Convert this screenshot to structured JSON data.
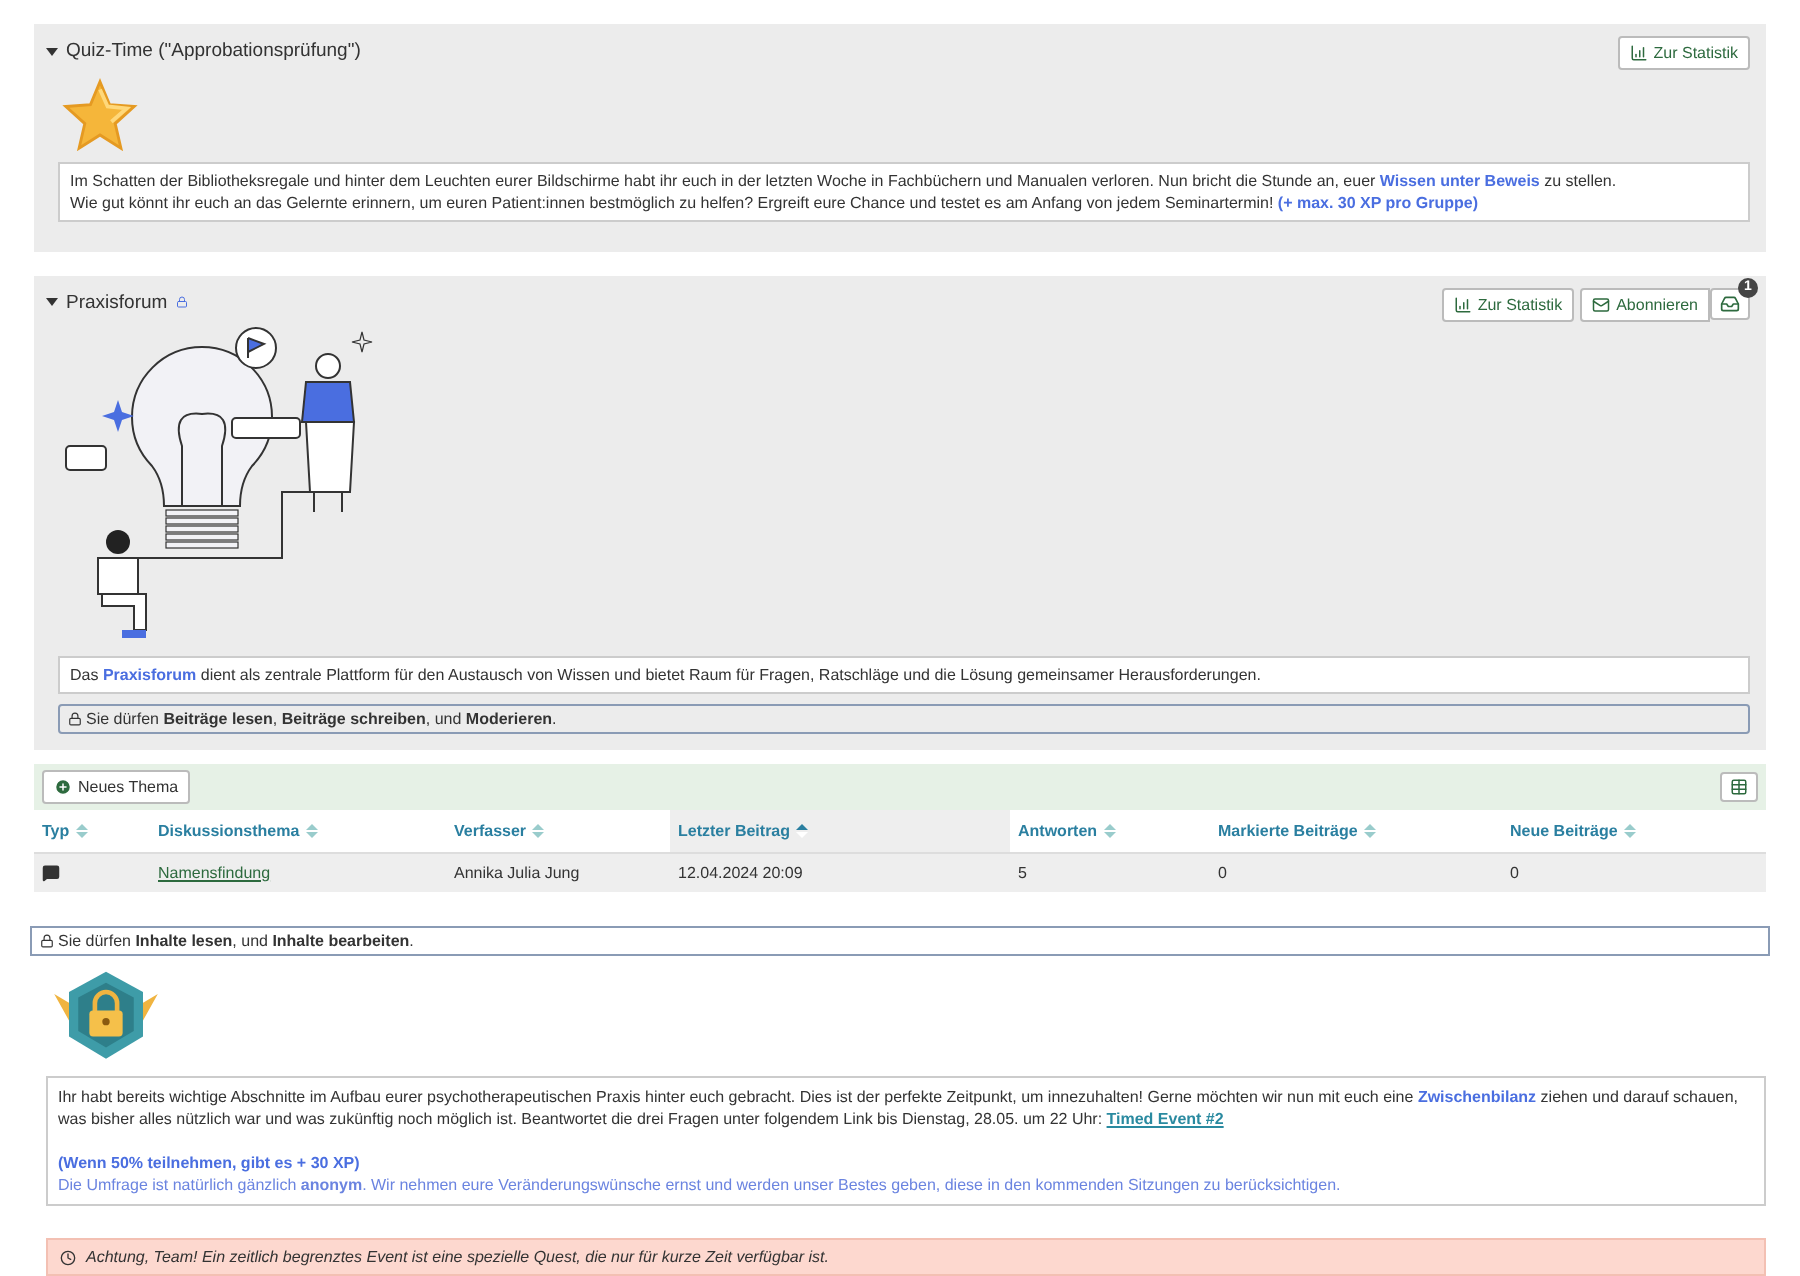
{
  "quiz_panel": {
    "title": "Quiz-Time (\"Approbationsprüfung\")",
    "expanded": true,
    "stat_button": "Zur Statistik",
    "text_lines": [
      [
        {
          "kind": "text",
          "text": "Im Schatten der Bibliotheksregale und hinter dem Leuchten eurer Bildschirme habt ihr euch in der letzten Woche in Fachbüchern und Manualen verloren. Nun bricht die Stunde an, euer "
        },
        {
          "kind": "accent",
          "text": "Wissen unter Beweis"
        },
        {
          "kind": "text",
          "text": " zu stellen."
        }
      ],
      [
        {
          "kind": "text",
          "text": "Wie gut könnt ihr euch an das Gelernte erinnern, um euren Patient:innen bestmöglich zu helfen? Ergreift eure Chance und testet es am Anfang von jedem Seminartermin! "
        },
        {
          "kind": "accent",
          "text": "(+ max. 30 XP pro Gruppe)"
        }
      ]
    ]
  },
  "forum_panel": {
    "title": "Praxisforum",
    "expanded": true,
    "stat_button": "Zur Statistik",
    "subscribe_button": "Abonnieren",
    "notification_count": "1",
    "description": [
      {
        "kind": "text",
        "text": "Das "
      },
      {
        "kind": "accent",
        "text": "Praxisforum"
      },
      {
        "kind": "text",
        "text": " dient als zentrale Plattform für den Austausch von Wissen und bietet Raum für Fragen, Ratschläge und die Lösung gemeinsamer Herausforderungen."
      }
    ],
    "permission": "Sie dürfen **Beiträge lesen**, **Beiträge schreiben**, und **Moderieren**."
  },
  "forum_table": {
    "new_topic_button": "Neues Thema",
    "columns": [
      {
        "label": "Typ",
        "sorted": false
      },
      {
        "label": "Diskussionsthema",
        "sorted": false
      },
      {
        "label": "Verfasser",
        "sorted": false
      },
      {
        "label": "Letzter Beitrag",
        "sorted": true
      },
      {
        "label": "Antworten",
        "sorted": false
      },
      {
        "label": "Markierte Beiträge",
        "sorted": false
      },
      {
        "label": "Neue Beiträge",
        "sorted": false
      }
    ],
    "rows": [
      {
        "topic": "Namensfindung",
        "author": "Annika Julia Jung",
        "last_post": "12.04.2024 20:09",
        "replies": "5",
        "marked": "0",
        "new": "0"
      }
    ]
  },
  "content_permission": "Sie dürfen **Inhalte lesen**, und **Inhalte bearbeiten**.",
  "event_text": [
    [
      {
        "kind": "text",
        "text": "Ihr habt bereits wichtige Abschnitte im Aufbau eurer psychotherapeutischen Praxis hinter euch gebracht. Dies ist der perfekte Zeitpunkt, um innezuhalten! Gerne möchten wir nun mit euch eine "
      },
      {
        "kind": "accent",
        "text": "Zwischenbilanz"
      },
      {
        "kind": "text",
        "text": " ziehen und darauf schauen, was bisher alles nützlich war und was zukünftig noch möglich ist. Beantwortet die drei Fragen unter folgendem Link bis Dienstag, 28.05. um 22 Uhr: "
      },
      {
        "kind": "link",
        "text": "Timed Event #2"
      }
    ],
    [
      {
        "kind": "accent",
        "text": "(Wenn 50% teilnehmen, gibt es + 30 XP)"
      }
    ],
    [
      {
        "kind": "note",
        "text": "Die Umfrage ist natürlich gänzlich "
      },
      {
        "kind": "note_bold",
        "text": "anonym"
      },
      {
        "kind": "note",
        "text": ". Wir nehmen eure Veränderungswünsche ernst und werden unser Bestes geben, diese in den kommenden Sitzungen zu berücksichtigen."
      }
    ]
  ],
  "alert": "Achtung, Team! Ein zeitlich begrenztes Event ist eine spezielle Quest, die nur für kurze Zeit verfügbar ist."
}
